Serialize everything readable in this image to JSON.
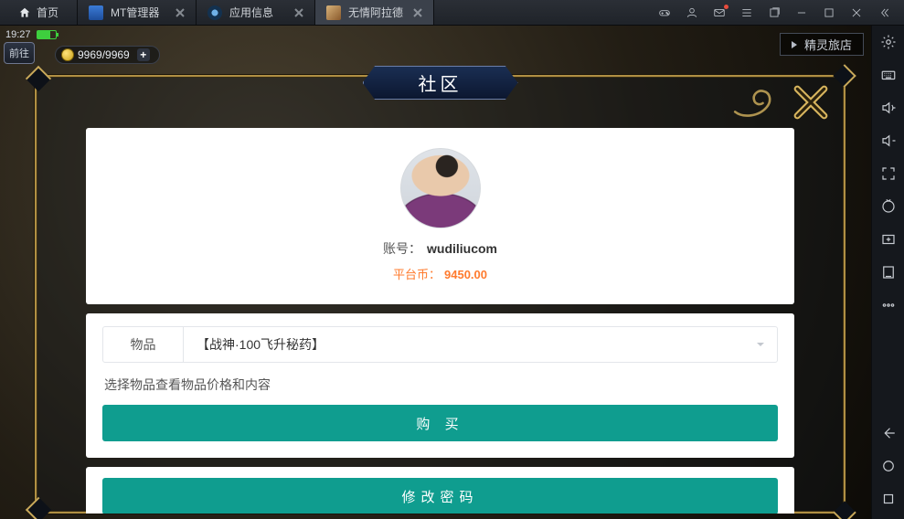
{
  "tabs": {
    "home": "首页",
    "items": [
      {
        "label": "MT管理器"
      },
      {
        "label": "应用信息"
      },
      {
        "label": "无情阿拉德"
      }
    ],
    "active_index": 2
  },
  "hud": {
    "clock": "19:27",
    "back_button": "前往",
    "gold": "9969/9969",
    "ad_label": "精灵旅店"
  },
  "dialog": {
    "title": "社区",
    "account_label": "账号：",
    "account_value": "wudiliucom",
    "coin_label": "平台币：",
    "coin_value": "9450.00",
    "select_label": "物品",
    "select_value": "【战神·100飞升秘药】",
    "hint": "选择物品查看物品价格和内容",
    "buy_button": "购 买",
    "change_pw_button": "修改密码"
  }
}
